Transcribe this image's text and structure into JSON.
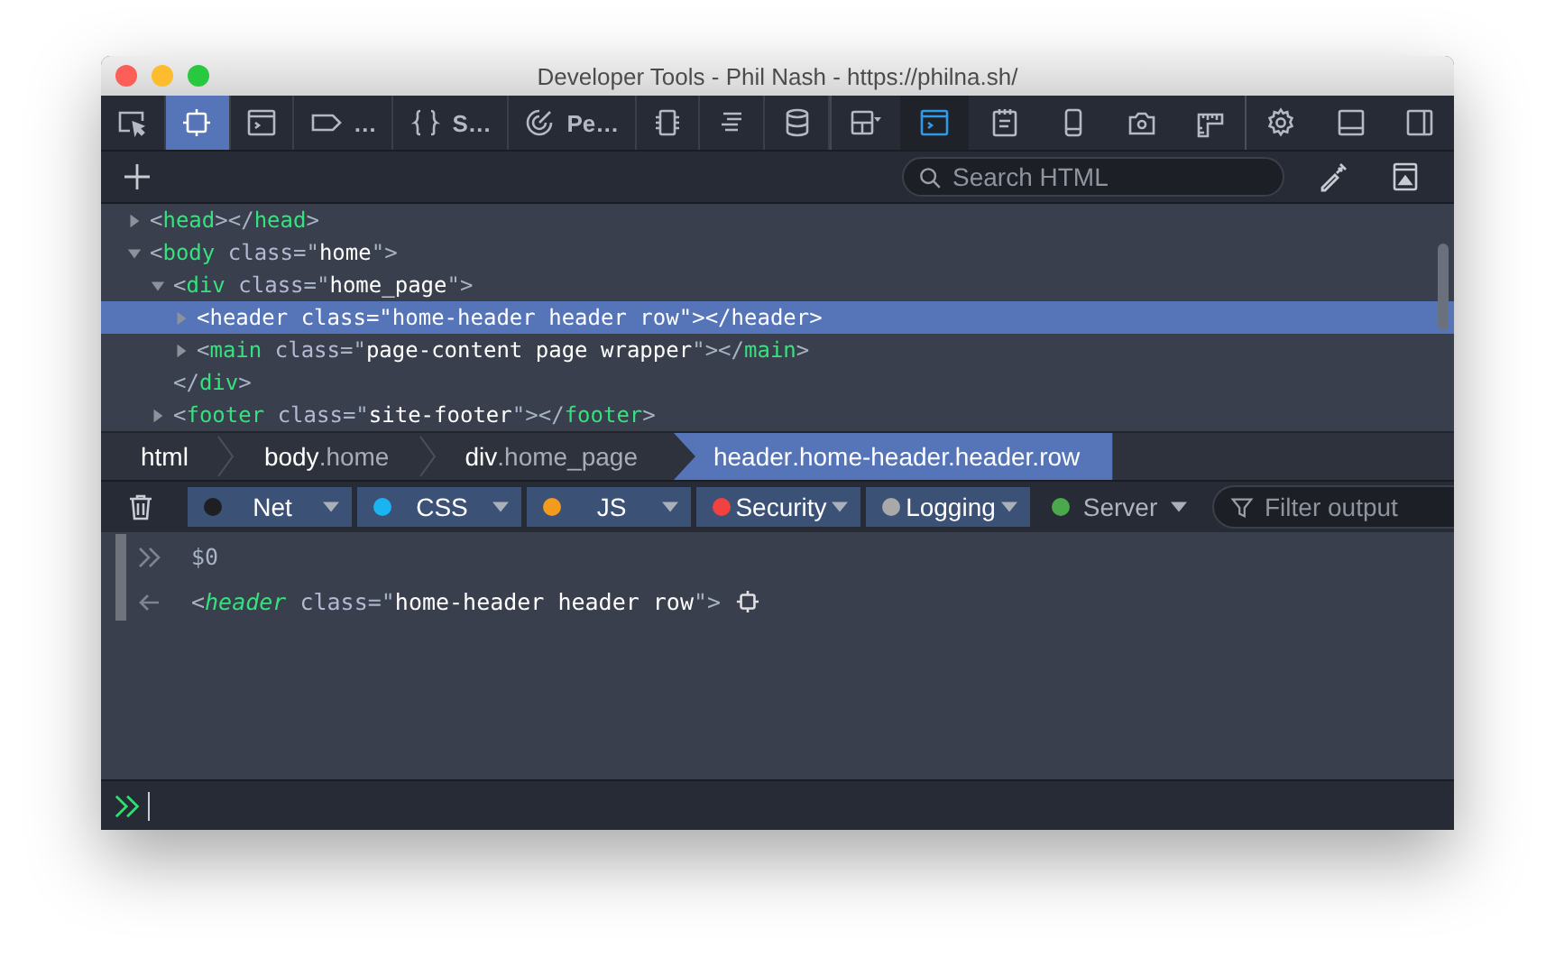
{
  "window": {
    "title": "Developer Tools - Phil Nash - https://philna.sh/"
  },
  "toolbar": {
    "tools": [
      {
        "selected": false
      },
      {
        "selected": true
      },
      {
        "selected": false
      },
      {
        "label": "…",
        "selected": false
      },
      {
        "label": "S…",
        "selected": false
      },
      {
        "label": "Pe…",
        "selected": false
      },
      {
        "selected": false
      },
      {
        "selected": false
      },
      {
        "selected": false
      }
    ],
    "options": [
      {
        "selected": false
      },
      {
        "selected": true
      },
      {
        "selected": false
      },
      {
        "selected": false
      },
      {
        "selected": false
      },
      {
        "selected": false
      },
      {
        "selected": false
      },
      {
        "selected": false
      },
      {
        "selected": false
      }
    ]
  },
  "inspector": {
    "search": {
      "placeholder": "Search HTML"
    },
    "nodes": [
      {
        "kind": "element",
        "text": "<head></head>",
        "expanded": false,
        "selected": false
      },
      {
        "kind": "element",
        "text": "<body class=\"home\">",
        "expanded": true,
        "selected": false,
        "children": [
          {
            "kind": "element",
            "text": "<div class=\"home_page\">",
            "expanded": true,
            "selected": false,
            "children": [
              {
                "kind": "element",
                "text": "<header class=\"home-header header row\"></header>",
                "expanded": false,
                "selected": true
              },
              {
                "kind": "element",
                "text": "<main class=\"page-content page wrapper\"></main>",
                "expanded": false,
                "selected": false
              }
            ]
          },
          {
            "kind": "closing",
            "text": "</div>"
          },
          {
            "kind": "element",
            "text": "<footer class=\"site-footer\"></footer>",
            "expanded": false,
            "selected": false
          }
        ]
      }
    ],
    "breadcrumbs": [
      {
        "tag": "html",
        "selected": false
      },
      {
        "tag": "body",
        "classes": ".home",
        "selected": false
      },
      {
        "tag": "div",
        "classes": ".home_page",
        "selected": false
      },
      {
        "tag": "header",
        "classes": ".home-header.header.row",
        "selected": true
      }
    ]
  },
  "console": {
    "filters": [
      {
        "label": "Net",
        "color": "#1e1f22",
        "selected": true
      },
      {
        "label": "CSS",
        "color": "#1bb4f2",
        "selected": true
      },
      {
        "label": "JS",
        "color": "#f29b1c",
        "selected": true
      },
      {
        "label": "Security",
        "color": "#f24141",
        "selected": true
      },
      {
        "label": "Logging",
        "color": "#a9a9a9",
        "selected": true
      },
      {
        "label": "Server",
        "color": "#4ca84c",
        "selected": false
      }
    ],
    "filter_field": {
      "placeholder": "Filter output"
    },
    "entries": [
      {
        "kind": "input",
        "text": "$0"
      },
      {
        "kind": "output",
        "text": "<header class=\"home-header header row\">"
      }
    ]
  }
}
